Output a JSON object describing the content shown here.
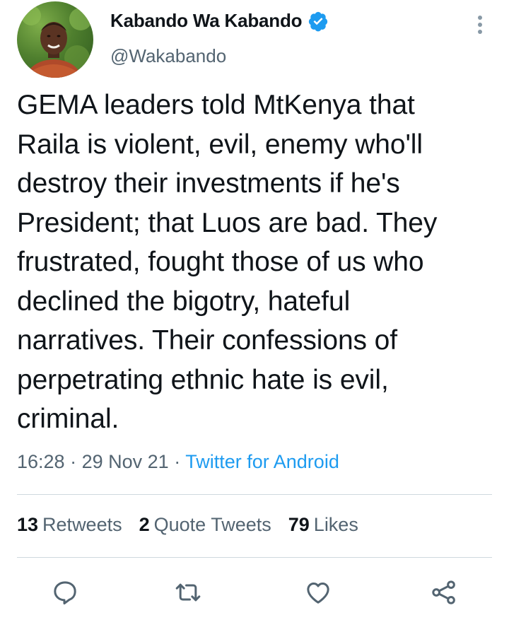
{
  "author": {
    "name": "Kabando Wa Kabando",
    "handle": "@Wakabando",
    "verified_icon": "verified-badge-icon"
  },
  "tweet": {
    "text": "GEMA leaders told MtKenya that\nRaila is violent, evil, enemy who'll\ndestroy their investments if he's\nPresident; that Luos are bad. They\nfrustrated, fought those of us who\ndeclined the bigotry, hateful\nnarratives. Their confessions of\nperpetrating ethnic hate is evil,\ncriminal.",
    "time": "16:28",
    "date": "29 Nov 21",
    "client": "Twitter for Android",
    "separator": "·"
  },
  "stats": {
    "retweets_count": "13",
    "retweets_label": "Retweets",
    "quotes_count": "2",
    "quotes_label": "Quote Tweets",
    "likes_count": "79",
    "likes_label": "Likes"
  },
  "actions": [
    "reply-icon",
    "retweet-icon",
    "like-icon",
    "share-icon"
  ],
  "colors": {
    "accent": "#1d9bf0",
    "text": "#0f1419",
    "muted": "#536471",
    "divider": "#cfd9de"
  }
}
